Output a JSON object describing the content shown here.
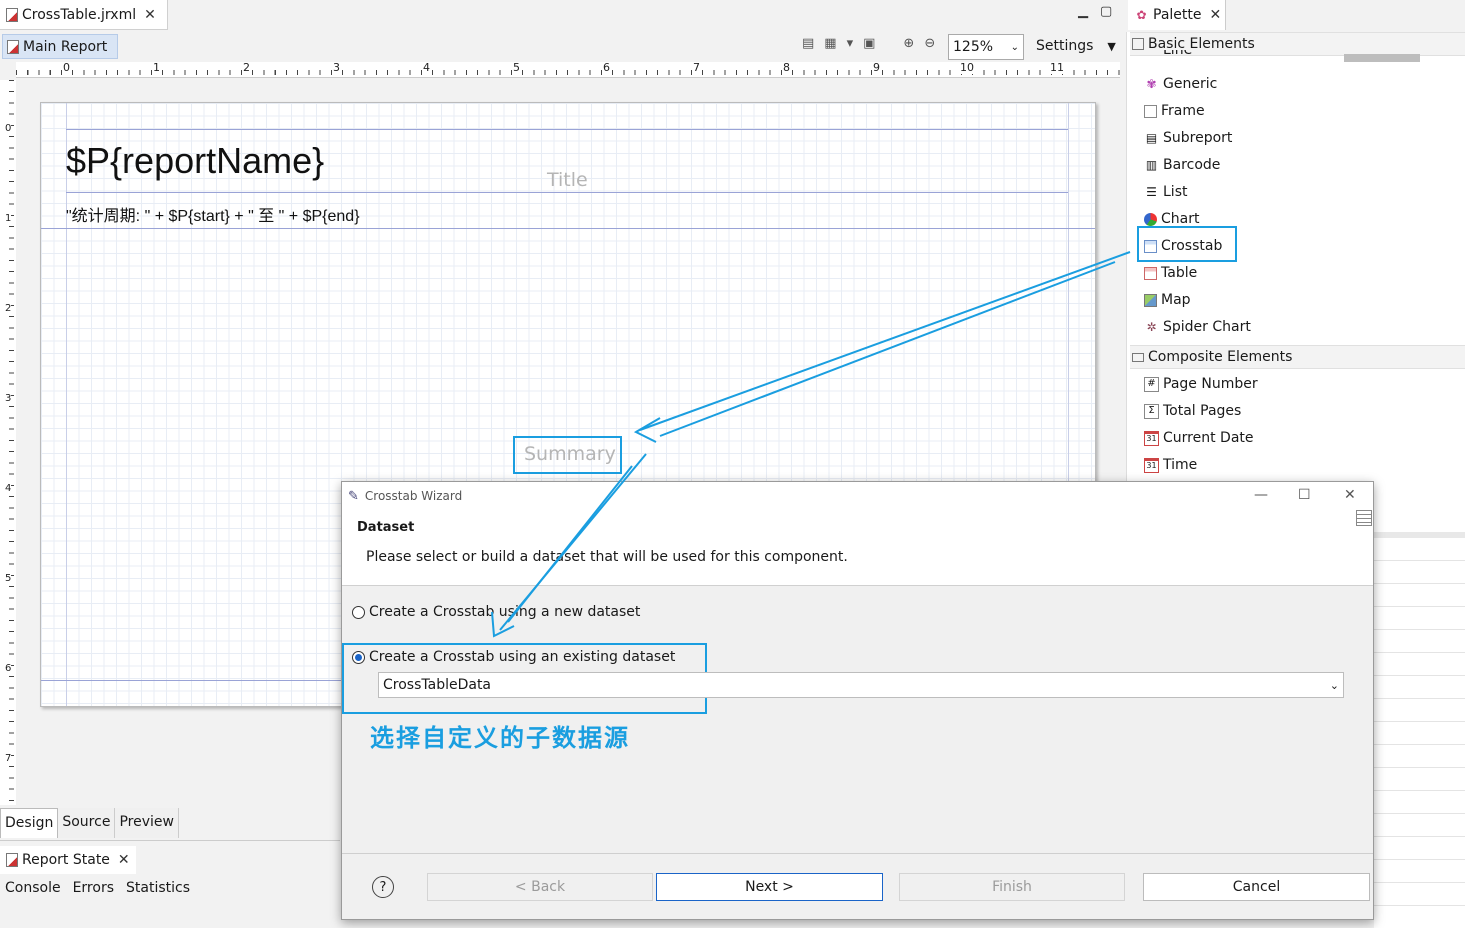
{
  "editor": {
    "file_tab": "CrossTable.jrxml",
    "subtab": "Main Report",
    "zoom": "125%",
    "settings": "Settings",
    "ruler_h": [
      "0",
      "1",
      "2",
      "3",
      "4",
      "5",
      "6",
      "7",
      "8",
      "9",
      "10",
      "11"
    ],
    "ruler_v": [
      "0",
      "1",
      "2",
      "3",
      "4",
      "5",
      "6",
      "7"
    ]
  },
  "report": {
    "title_field": "$P{reportName}",
    "title_band": "Title",
    "expression": "\"统计周期: \" + $P{start} + \" 至 \" + $P{end}",
    "summary_band": "Summary"
  },
  "bottom": {
    "tabs": [
      "Design",
      "Source",
      "Preview"
    ],
    "report_state": "Report State",
    "views": [
      "Console",
      "Errors",
      "Statistics"
    ]
  },
  "palette": {
    "tab": "Palette",
    "basic_header": "Basic Elements",
    "partial_item": "Line",
    "basic_items": [
      "Generic",
      "Frame",
      "Subreport",
      "Barcode",
      "List",
      "Chart",
      "Crosstab",
      "Table",
      "Map",
      "Spider Chart"
    ],
    "composite_header": "Composite Elements",
    "composite_items": [
      "Page Number",
      "Total Pages",
      "Current Date",
      "Time"
    ]
  },
  "dialog": {
    "title": "Crosstab Wizard",
    "heading": "Dataset",
    "description": "Please select or build a dataset that will be used for this component.",
    "option_new": "Create a Crosstab using a new dataset",
    "option_existing": "Create a Crosstab using an existing dataset",
    "dataset_value": "CrossTableData",
    "buttons": {
      "back": "< Back",
      "next": "Next >",
      "finish": "Finish",
      "cancel": "Cancel"
    }
  },
  "annotation": "选择自定义的子数据源",
  "colors": {
    "highlight": "#1a9ee0",
    "selection": "#1a64c8"
  }
}
